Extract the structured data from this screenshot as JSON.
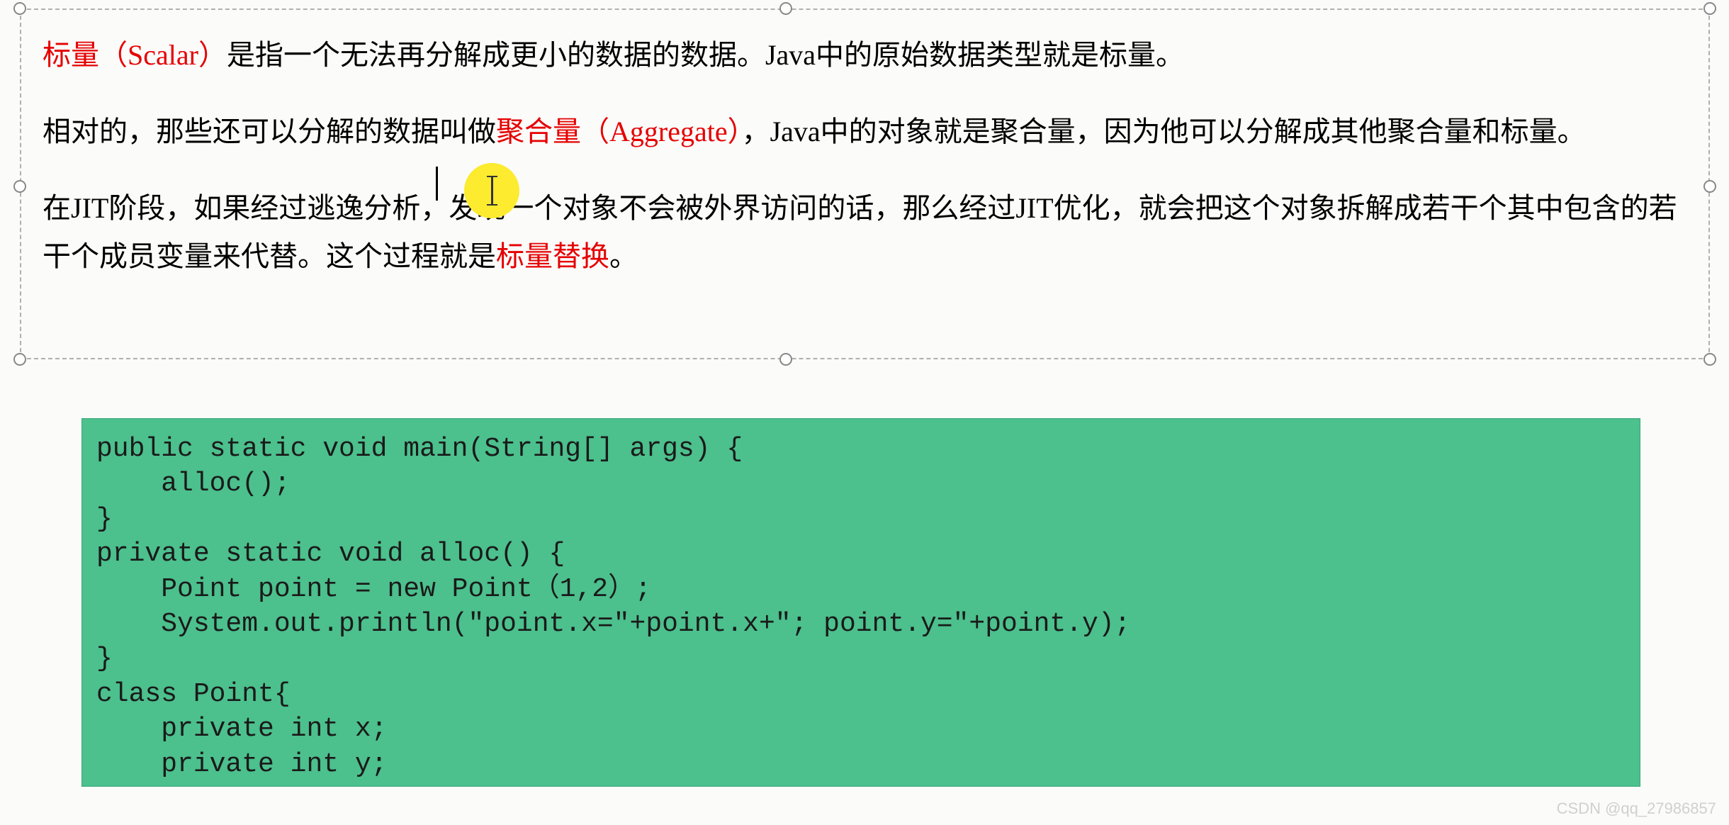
{
  "textbox": {
    "p1": {
      "red1": "标量（Scalar）",
      "black1": "是指一个无法再分解成更小的数据的数据。Java中的原始数据类型就是标量。"
    },
    "p2": {
      "black1": "相对的，那些还可以分解的数据叫做",
      "red1": "聚合量（Aggregate）",
      "black2": "，Java中的对象就是聚合量，因为他可以分解成其他聚合量和标量。"
    },
    "p3": {
      "black1": "在JIT阶段，如果经过逃逸分析，发现一个对象不会被外界访问的话，那么经过JIT优化，就会把这个对象拆解成若干个其中包含的若干个成员变量来代替。这个过程就是",
      "red1": "标量替换",
      "black2": "。"
    }
  },
  "code": "public static void main(String[] args) {\n    alloc();\n}\nprivate static void alloc() {\n    Point point = new Point（1,2）;\n    System.out.println(\"point.x=\"+point.x+\"; point.y=\"+point.y);\n}\nclass Point{\n    private int x;\n    private int y;\n}",
  "watermark": "CSDN @qq_27986857"
}
